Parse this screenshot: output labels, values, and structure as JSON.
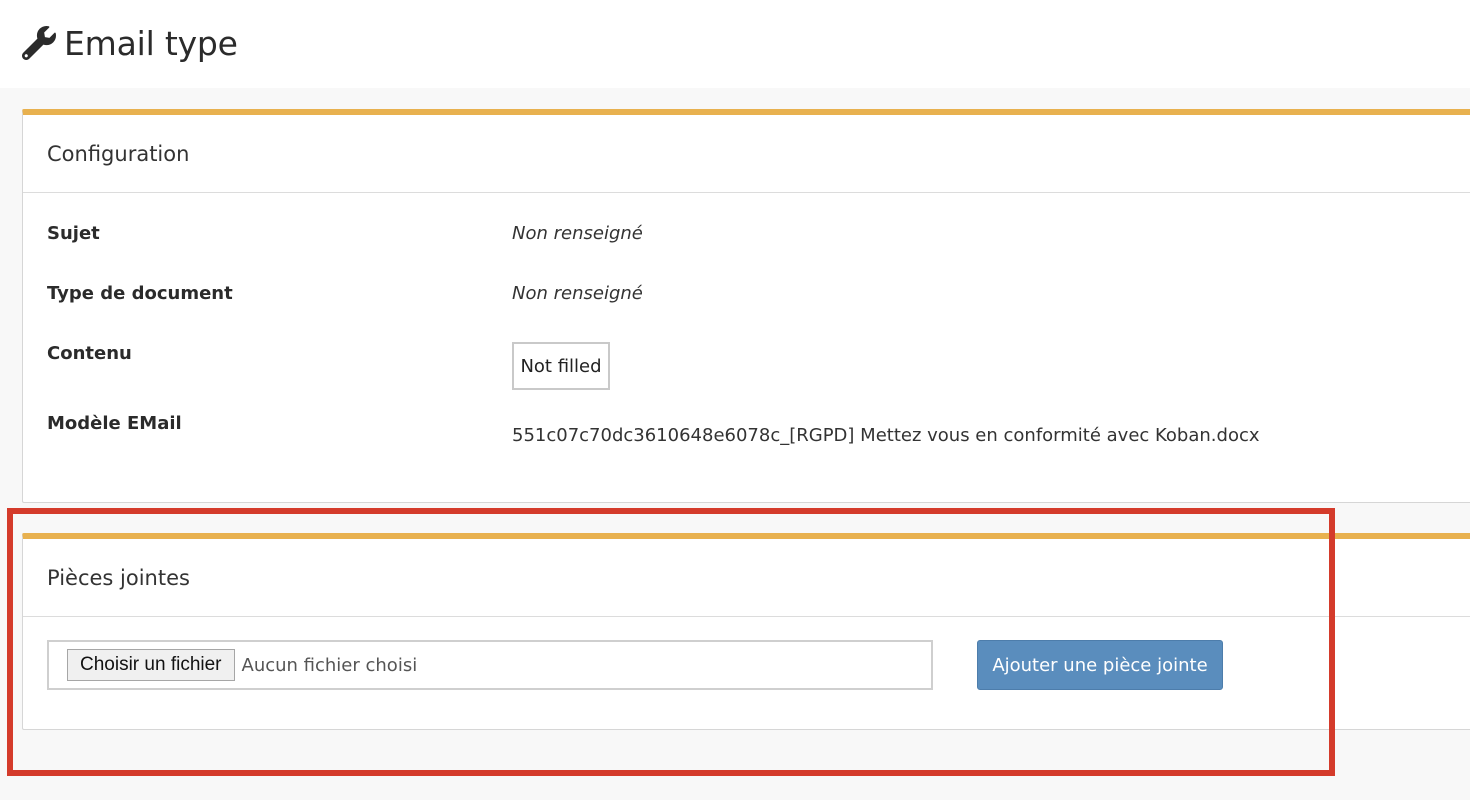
{
  "header": {
    "title": "Email type",
    "icon": "wrench-icon"
  },
  "configuration": {
    "heading": "Configuration",
    "fields": [
      {
        "label": "Sujet",
        "value": "Non renseigné"
      },
      {
        "label": "Type de document",
        "value": "Non renseigné"
      },
      {
        "label": "Contenu",
        "value": "Not filled"
      },
      {
        "label": "Modèle EMail",
        "value": "551c07c70dc3610648e6078c_[RGPD] Mettez vous en conformité avec Koban.docx"
      }
    ]
  },
  "attachments": {
    "heading": "Pièces jointes",
    "file_button_label": "Choisir un fichier",
    "file_status": "Aucun fichier choisi",
    "add_button_label": "Ajouter une pièce jointe"
  },
  "colors": {
    "panel_accent": "#e8b14f",
    "primary_button": "#5a8dbd",
    "highlight": "#d43b2b"
  }
}
